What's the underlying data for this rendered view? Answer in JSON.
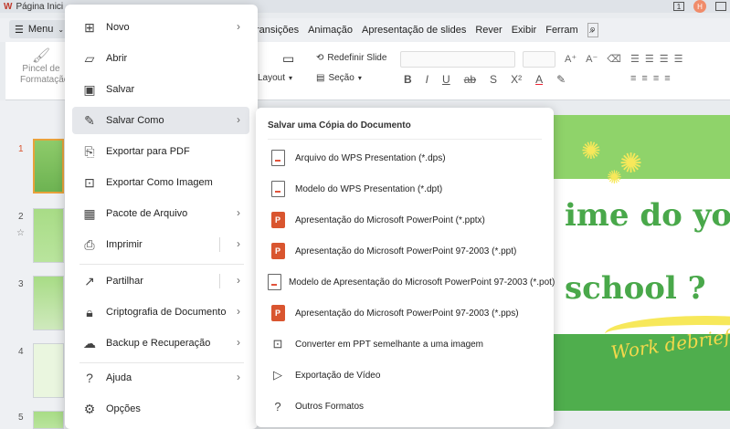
{
  "titlebar": {
    "tab_label": "Página Inici",
    "avatar_initial": "H"
  },
  "toolbar": {
    "menu_label": "Menu",
    "tabs": [
      "ransições",
      "Animação",
      "Apresentação de slides",
      "Rever",
      "Exibir",
      "Ferram"
    ]
  },
  "ribbon": {
    "pincel_label": "Pincel de Formatação",
    "redefinir_label": "Redefinir Slide",
    "layout_label": "Layout",
    "secao_label": "Seção"
  },
  "thumbnails": {
    "numbers": [
      "1",
      "2",
      "3",
      "4",
      "5"
    ]
  },
  "slide": {
    "line1": "ime do you",
    "line2": "school ?",
    "line3": "Work debriefin"
  },
  "main_menu": {
    "items": [
      {
        "label": "Novo",
        "icon": "new-icon"
      },
      {
        "label": "Abrir",
        "icon": "folder-icon"
      },
      {
        "label": "Salvar",
        "icon": "save-icon"
      },
      {
        "label": "Salvar Como",
        "icon": "save-as-icon"
      },
      {
        "label": "Exportar para PDF",
        "icon": "pdf-export-icon"
      },
      {
        "label": "Exportar Como Imagem",
        "icon": "image-export-icon"
      },
      {
        "label": "Pacote de Arquivo",
        "icon": "package-icon"
      },
      {
        "label": "Imprimir",
        "icon": "print-icon"
      },
      {
        "label": "Partilhar",
        "icon": "share-icon"
      },
      {
        "label": "Criptografia de Documento",
        "icon": "encrypt-icon"
      },
      {
        "label": "Backup e Recuperação",
        "icon": "backup-icon"
      },
      {
        "label": "Ajuda",
        "icon": "help-icon"
      },
      {
        "label": "Opções",
        "icon": "options-icon"
      }
    ]
  },
  "save_as_submenu": {
    "title": "Salvar uma Cópia do Documento",
    "items": [
      {
        "label": "Arquivo do WPS Presentation (*.dps)",
        "icon": "wps-doc-icon"
      },
      {
        "label": "Modelo do WPS Presentation (*.dpt)",
        "icon": "wps-doc-icon"
      },
      {
        "label": "Apresentação do Microsoft PowerPoint (*.pptx)",
        "icon": "ppt-icon"
      },
      {
        "label": "Apresentação do Microsoft PowerPoint 97-2003 (*.ppt)",
        "icon": "ppt-icon"
      },
      {
        "label": "Modelo de Apresentação do Microsoft PowerPoint 97-2003 (*.pot)",
        "icon": "wps-doc-icon"
      },
      {
        "label": "Apresentação do Microsoft PowerPoint 97-2003 (*.pps)",
        "icon": "ppt-icon"
      },
      {
        "label": "Converter em PPT semelhante a uma imagem",
        "icon": "convert-image-icon"
      },
      {
        "label": "Exportação de Vídeo",
        "icon": "video-icon"
      },
      {
        "label": "Outros Formatos",
        "icon": "other-formats-icon"
      }
    ]
  }
}
